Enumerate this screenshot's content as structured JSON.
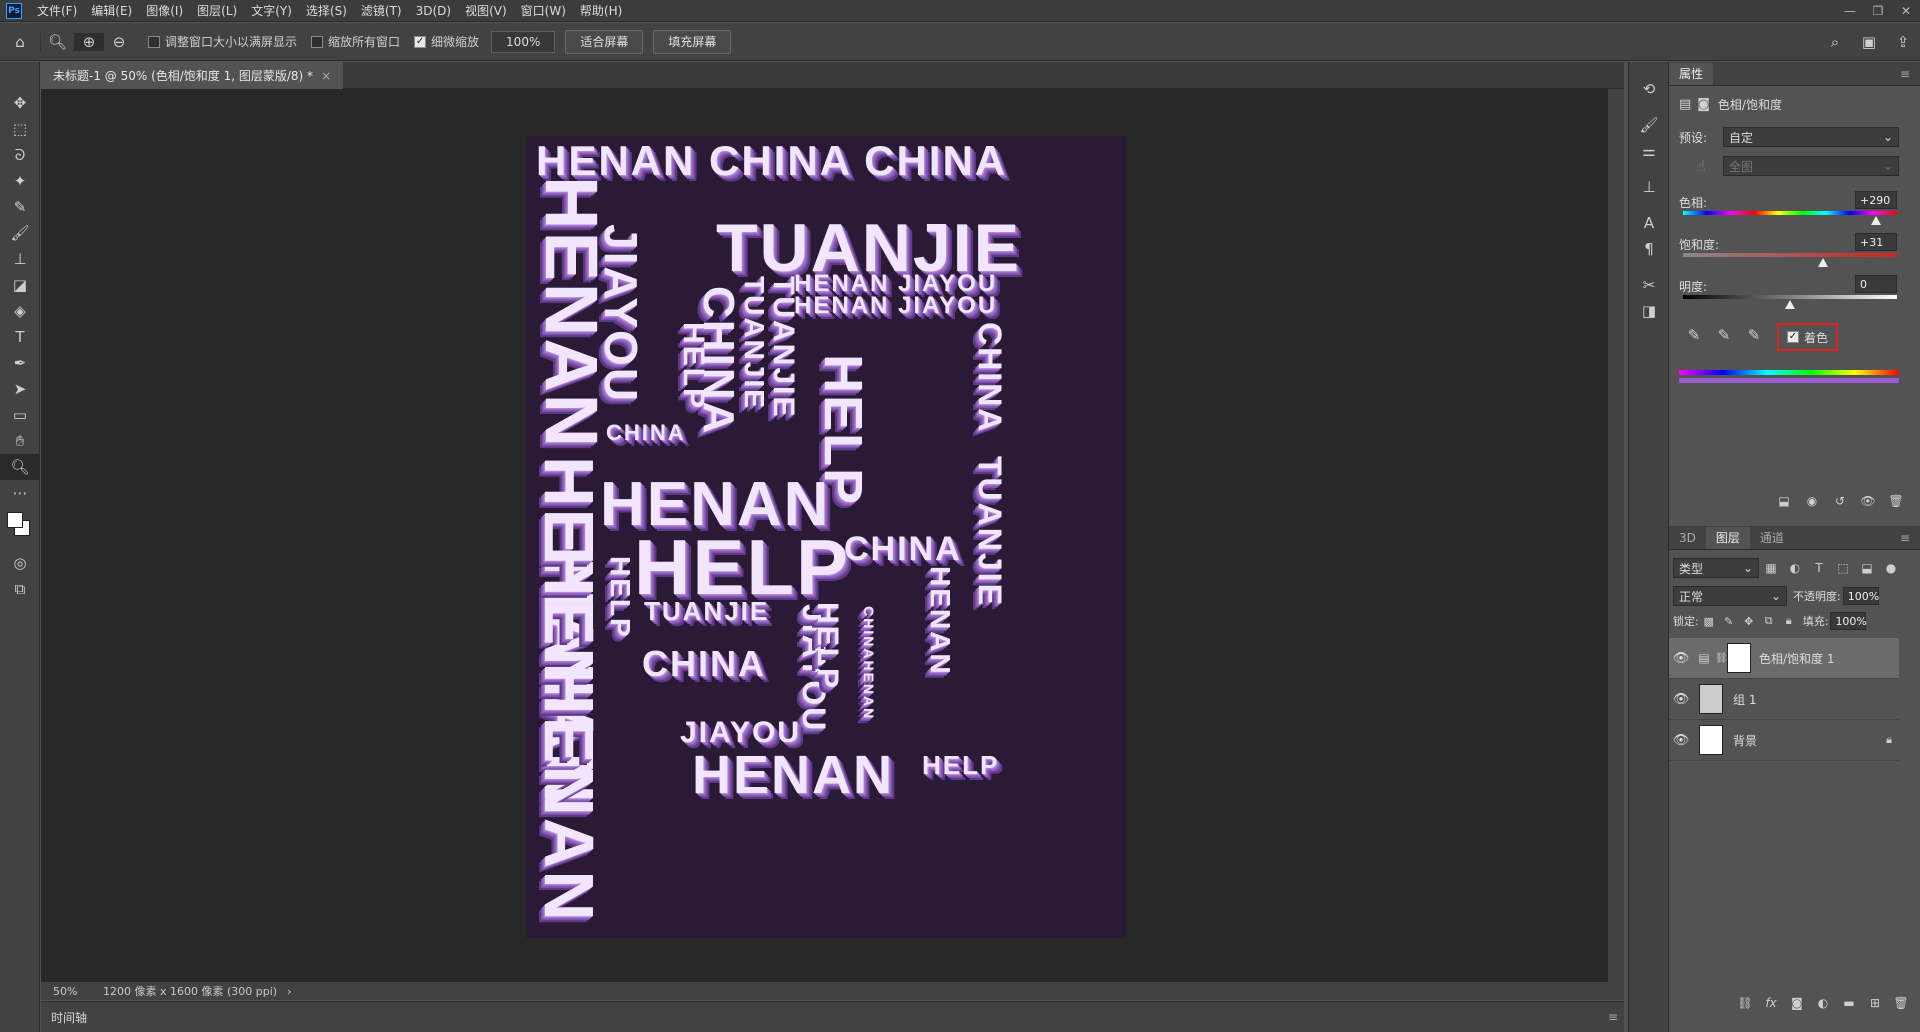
{
  "menubar": {
    "logo": "Ps",
    "items": [
      "文件(F)",
      "编辑(E)",
      "图像(I)",
      "图层(L)",
      "文字(Y)",
      "选择(S)",
      "滤镜(T)",
      "3D(D)",
      "视图(V)",
      "窗口(W)",
      "帮助(H)"
    ]
  },
  "options": {
    "resize_windows_label": "调整窗口大小以满屏显示",
    "zoom_all_label": "缩放所有窗口",
    "scrubby_zoom_label": "细微缩放",
    "zoom_value": "100%",
    "fit_screen_label": "适合屏幕",
    "fill_screen_label": "填充屏幕"
  },
  "document": {
    "tab_title": "未标题-1 @ 50% (色相/饱和度 1, 图层蒙版/8) *",
    "poster_words": [
      "HENAN CHINA CHINA",
      "HENAN",
      "JIAYOU",
      "TUANJIE",
      "HENAN JIAYOU",
      "HENAN JIAYOU",
      "CHINA",
      "TUANJIE",
      "HELP",
      "HELP",
      "CHINA",
      "HENAN",
      "HELP",
      "TUANJIE",
      "CHINA",
      "HENAN",
      "HENAN",
      "HENAN",
      "JIAYOU",
      "HENAN",
      "HELP",
      "CHINA",
      "TUANJIE",
      "JIAYOU",
      "HELP",
      "CHINA",
      "TUANJIE",
      "HENAN",
      "HELP",
      "CHINAHENAN"
    ]
  },
  "status": {
    "zoom": "50%",
    "doc_info": "1200 像素 x 1600 像素 (300 ppi)"
  },
  "timeline": {
    "label": "时间轴"
  },
  "properties": {
    "tab_label": "属性",
    "adjustment_name": "色相/饱和度",
    "preset_label": "预设:",
    "preset_value": "自定",
    "channel_value": "全图",
    "hue_label": "色相:",
    "hue_value": "+290",
    "hue_fraction": 0.903,
    "saturation_label": "饱和度:",
    "saturation_value": "+31",
    "saturation_fraction": 0.655,
    "lightness_label": "明度:",
    "lightness_value": "0",
    "lightness_fraction": 0.5,
    "colorize_label": "着色",
    "colorize_checked": true
  },
  "layers_panel": {
    "tabs": [
      "3D",
      "图层",
      "通道"
    ],
    "filter_label": "类型",
    "blend_mode": "正常",
    "opacity_label": "不透明度:",
    "opacity_value": "100%",
    "lock_label": "锁定:",
    "fill_label": "填充:",
    "fill_value": "100%",
    "layers": [
      {
        "name": "色相/饱和度 1"
      },
      {
        "name": "组 1"
      },
      {
        "name": "背景"
      }
    ]
  },
  "colors": {
    "highlight": "#e02020",
    "accent": "#31a8ff",
    "poster_bg": "#2a1a35"
  }
}
